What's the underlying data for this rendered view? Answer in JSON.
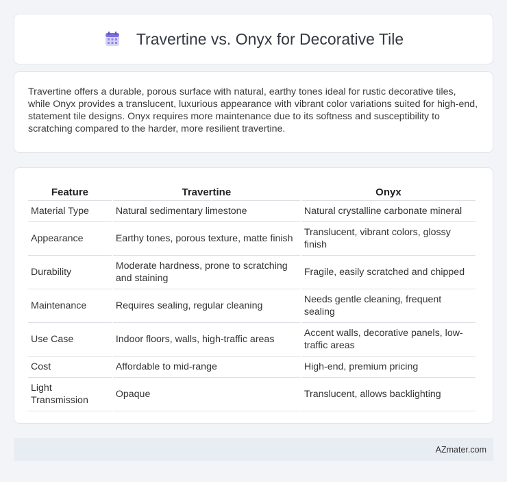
{
  "header": {
    "title": "Travertine vs. Onyx for Decorative Tile",
    "icon": "calendar-icon",
    "icon_colors": {
      "top": "#7b6fe0",
      "body": "#c9c4f2",
      "grid": "#8f86e6"
    }
  },
  "intro": {
    "text": "Travertine offers a durable, porous surface with natural, earthy tones ideal for rustic decorative tiles, while Onyx provides a translucent, luxurious appearance with vibrant color variations suited for high-end, statement tile designs. Onyx requires more maintenance due to its softness and susceptibility to scratching compared to the harder, more resilient travertine."
  },
  "table": {
    "headers": [
      "Feature",
      "Travertine",
      "Onyx"
    ],
    "rows": [
      [
        "Material Type",
        "Natural sedimentary limestone",
        "Natural crystalline carbonate mineral"
      ],
      [
        "Appearance",
        "Earthy tones, porous texture, matte finish",
        "Translucent, vibrant colors, glossy finish"
      ],
      [
        "Durability",
        "Moderate hardness, prone to scratching and staining",
        "Fragile, easily scratched and chipped"
      ],
      [
        "Maintenance",
        "Requires sealing, regular cleaning",
        "Needs gentle cleaning, frequent sealing"
      ],
      [
        "Use Case",
        "Indoor floors, walls, high-traffic areas",
        "Accent walls, decorative panels, low-traffic areas"
      ],
      [
        "Cost",
        "Affordable to mid-range",
        "High-end, premium pricing"
      ],
      [
        "Light Transmission",
        "Opaque",
        "Translucent, allows backlighting"
      ]
    ]
  },
  "footer": {
    "text": "AZmater.com"
  }
}
